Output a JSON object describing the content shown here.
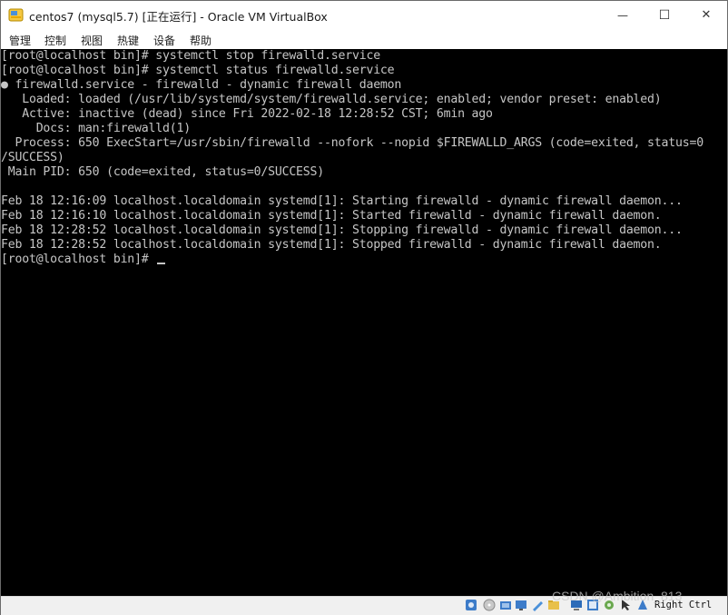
{
  "window": {
    "title": "centos7 (mysql5.7) [正在运行] - Oracle VM VirtualBox",
    "minimize_glyph": "—",
    "maximize_glyph": "☐",
    "close_glyph": "✕"
  },
  "menu": {
    "items": [
      "管理",
      "控制",
      "视图",
      "热键",
      "设备",
      "帮助"
    ]
  },
  "terminal": {
    "lines": [
      "[root@localhost bin]# systemctl stop firewalld.service",
      "[root@localhost bin]# systemctl status firewalld.service",
      "● firewalld.service - firewalld - dynamic firewall daemon",
      "   Loaded: loaded (/usr/lib/systemd/system/firewalld.service; enabled; vendor preset: enabled)",
      "   Active: inactive (dead) since Fri 2022-02-18 12:28:52 CST; 6min ago",
      "     Docs: man:firewalld(1)",
      "  Process: 650 ExecStart=/usr/sbin/firewalld --nofork --nopid $FIREWALLD_ARGS (code=exited, status=0",
      "/SUCCESS)",
      " Main PID: 650 (code=exited, status=0/SUCCESS)",
      "",
      "Feb 18 12:16:09 localhost.localdomain systemd[1]: Starting firewalld - dynamic firewall daemon...",
      "Feb 18 12:16:10 localhost.localdomain systemd[1]: Started firewalld - dynamic firewall daemon.",
      "Feb 18 12:28:52 localhost.localdomain systemd[1]: Stopping firewalld - dynamic firewall daemon...",
      "Feb 18 12:28:52 localhost.localdomain systemd[1]: Stopped firewalld - dynamic firewall daemon.",
      "[root@localhost bin]# "
    ]
  },
  "statusbar": {
    "icons": [
      "disk-icon",
      "optical-drive-icon",
      "audio-icon",
      "network-icon",
      "usb-icon",
      "shared-folder-icon",
      "display-icon",
      "recording-icon",
      "cpu-icon",
      "mouse-integration-icon",
      "keyboard-icon"
    ],
    "host_key": "Right Ctrl"
  },
  "watermark": "CSDN @Ambition_813"
}
